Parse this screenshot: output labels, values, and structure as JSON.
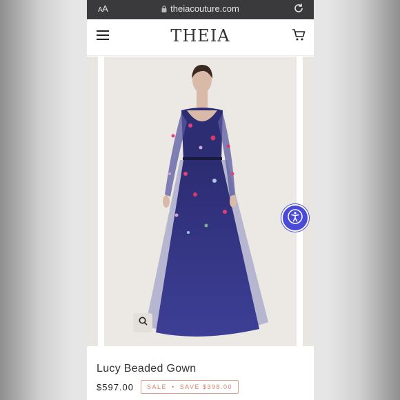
{
  "browser": {
    "text_size_label_small": "A",
    "text_size_label_large": "A",
    "url": "theiacouture.com"
  },
  "header": {
    "logo": "THEIA"
  },
  "product": {
    "name": "Lucy Beaded Gown",
    "price": "$597.00",
    "sale_label": "SALE",
    "separator": "•",
    "save_label": "SAVE $398.00"
  },
  "icons": {
    "menu": "hamburger-icon",
    "cart": "cart-icon",
    "zoom": "search-icon",
    "accessibility": "accessibility-icon",
    "lock": "lock-icon",
    "reload": "reload-icon"
  },
  "colors": {
    "accent_sale": "#d9826a",
    "gown_navy": "#2f2f7a",
    "accessibility_blue": "#4a4ad8"
  }
}
